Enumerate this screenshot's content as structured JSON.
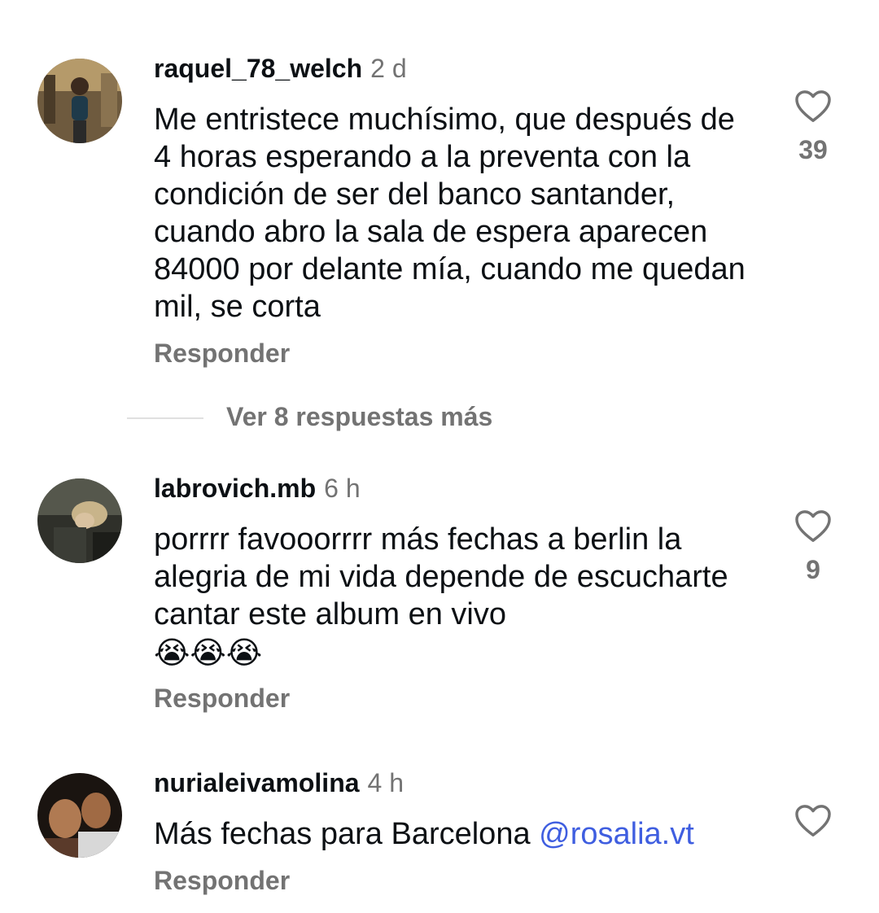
{
  "comments": [
    {
      "username": "raquel_78_welch",
      "time": "2 d",
      "text": "Me entristece muchísimo,  que después de 4 horas esperando a la preventa con la condición de ser del banco santander, cuando abro la sala de espera aparecen 84000 por delante mía,  cuando me quedan mil, se corta",
      "reply_label": "Responder",
      "likes": "39",
      "avatar_icon": "user-photo-avatar"
    },
    {
      "username": "labrovich.mb",
      "time": "6 h",
      "text": "porrrr favooorrrr más fechas a berlin la alegria de mi vida depende de escucharte cantar este album en vivo",
      "emoji": "😭😭😭",
      "reply_label": "Responder",
      "likes": "9",
      "avatar_icon": "user-photo-avatar"
    },
    {
      "username": "nurialeivamolina",
      "time": "4 h",
      "text": "Más fechas para Barcelona ",
      "mention": "@rosalia.vt",
      "reply_label": "Responder",
      "likes": "",
      "avatar_icon": "user-photo-avatar"
    }
  ],
  "more_replies": "Ver 8 respuestas más",
  "colors": {
    "text": "#0c1014",
    "secondary": "#737373",
    "mention": "#3f5ee0",
    "divider": "#e0e0e0"
  },
  "icons": {
    "like": "heart-outline-icon",
    "emoji": "loudly-crying-face"
  }
}
